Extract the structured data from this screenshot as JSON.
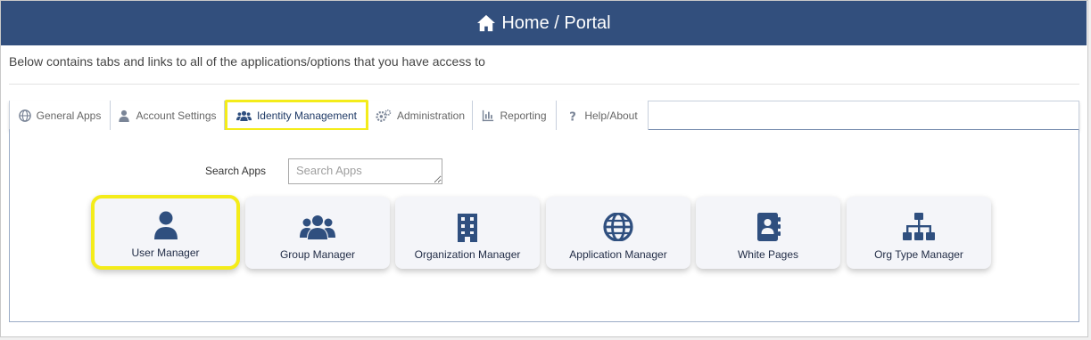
{
  "header": {
    "title": "Home / Portal",
    "icon": "home-icon"
  },
  "subtitle": "Below contains tabs and links to all of the applications/options that you have access to",
  "tabs": [
    {
      "label": "General Apps",
      "icon": "globe-icon"
    },
    {
      "label": "Account Settings",
      "icon": "user-icon"
    },
    {
      "label": "Identity Management",
      "icon": "users-icon",
      "active": true
    },
    {
      "label": "Administration",
      "icon": "gears-icon"
    },
    {
      "label": "Reporting",
      "icon": "bar-chart-icon"
    },
    {
      "label": "Help/About",
      "icon": "question-icon"
    }
  ],
  "search": {
    "label": "Search Apps",
    "placeholder": "Search Apps",
    "value": ""
  },
  "apps": [
    {
      "label": "User Manager",
      "icon": "user-icon",
      "highlighted": true
    },
    {
      "label": "Group Manager",
      "icon": "users-icon"
    },
    {
      "label": "Organization Manager",
      "icon": "building-icon"
    },
    {
      "label": "Application Manager",
      "icon": "globe-icon"
    },
    {
      "label": "White Pages",
      "icon": "address-book-icon"
    },
    {
      "label": "Org Type Manager",
      "icon": "sitemap-icon"
    }
  ],
  "colors": {
    "header_bg": "#324f7d",
    "highlight": "#f4ec1a",
    "icon": "#2f4f7f"
  }
}
